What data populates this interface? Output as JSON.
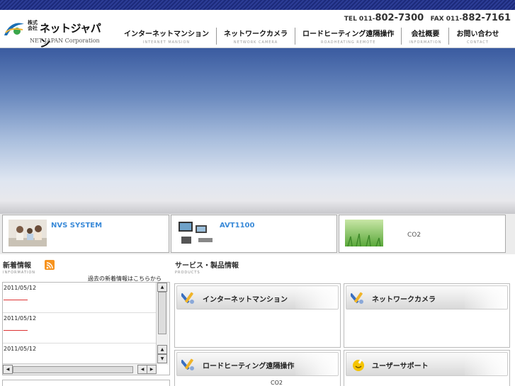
{
  "header": {
    "logo": {
      "kabushiki": "株式会社",
      "name": "ネットジャパン",
      "english": "NET JAPAN Corporation"
    },
    "tel_label": "TEL 011-",
    "tel_num": "802-7300",
    "fax_label": "FAX 011-",
    "fax_num": "882-7161",
    "nav": [
      {
        "jp": "インターネットマンション",
        "en": "INTERNET MANSION"
      },
      {
        "jp": "ネットワークカメラ",
        "en": "NETWORK CAMERA"
      },
      {
        "jp": "ロードヒーティング遠隔操作",
        "en": "ROADHEATING REMOTE"
      },
      {
        "jp": "会社概要",
        "en": "INFORMATION"
      },
      {
        "jp": "お問い合わせ",
        "en": "CONTACT"
      }
    ]
  },
  "banners": [
    {
      "title": "NVS SYSTEM"
    },
    {
      "title": "AVT1100"
    },
    {
      "title": "CO2"
    }
  ],
  "news": {
    "title": "新着情報",
    "sub": "INFORMATION",
    "past_link": "過去の新着情報はこちらから",
    "items": [
      {
        "date": "2011/05/12"
      },
      {
        "date": "2011/05/12"
      },
      {
        "date": "2011/05/12"
      }
    ]
  },
  "products": {
    "title": "サービス・製品情報",
    "sub": "PRODUCTS",
    "cards": [
      {
        "label": "インターネットマンション",
        "icon": "wrench-pen-icon"
      },
      {
        "label": "ネットワークカメラ",
        "icon": "wrench-pen-icon"
      },
      {
        "label": "ロードヒーティング遠隔操作",
        "icon": "wrench-pen-icon",
        "note": "CO2"
      },
      {
        "label": "ユーザーサポート",
        "icon": "support-icon"
      }
    ]
  },
  "colors": {
    "topbar": "#1c2a7a",
    "banner_title": "#3a8ad8",
    "rss": "#f7931e",
    "news_line": "#dd3333"
  }
}
